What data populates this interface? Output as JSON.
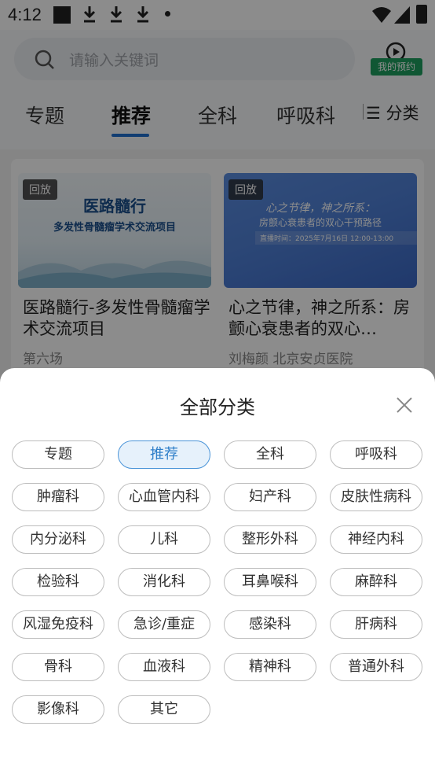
{
  "status_bar": {
    "time": "4:12"
  },
  "search": {
    "placeholder": "请输入关键词"
  },
  "appointment": {
    "label": "我的预约"
  },
  "tabs": [
    {
      "label": "专题"
    },
    {
      "label": "推荐"
    },
    {
      "label": "全科"
    },
    {
      "label": "呼吸科"
    }
  ],
  "category_button": {
    "label": "分类"
  },
  "cards": [
    {
      "badge": "回放",
      "thumb_text": "医路髓行",
      "thumb_sub": "多发性骨髓瘤学术交流项目",
      "title": "医路髓行-多发性骨髓瘤学术交流项目",
      "sub": "第六场"
    },
    {
      "badge": "回放",
      "thumb_text": "心之节律，神之所系：",
      "thumb_sub": "房颤心衰患者的双心干预路径",
      "thumb_date": "直播时间：2025年7月16日 12:00-13:00",
      "title": "心之节律，神之所系：房颤心衰患者的双心…",
      "sub": "刘梅颜  北京安贞医院"
    }
  ],
  "sheet": {
    "title": "全部分类",
    "categories": [
      "专题",
      "推荐",
      "全科",
      "呼吸科",
      "肿瘤科",
      "心血管内科",
      "妇产科",
      "皮肤性病科",
      "内分泌科",
      "儿科",
      "整形外科",
      "神经内科",
      "检验科",
      "消化科",
      "耳鼻喉科",
      "麻醉科",
      "风湿免疫科",
      "急诊/重症",
      "感染科",
      "肝病科",
      "骨科",
      "血液科",
      "精神科",
      "普通外科",
      "影像科",
      "其它"
    ],
    "selected": "推荐"
  },
  "colors": {
    "accent": "#1f6fd0",
    "selected_chip_bg": "#e6f1fb",
    "appointment_green": "#1e9f60"
  }
}
